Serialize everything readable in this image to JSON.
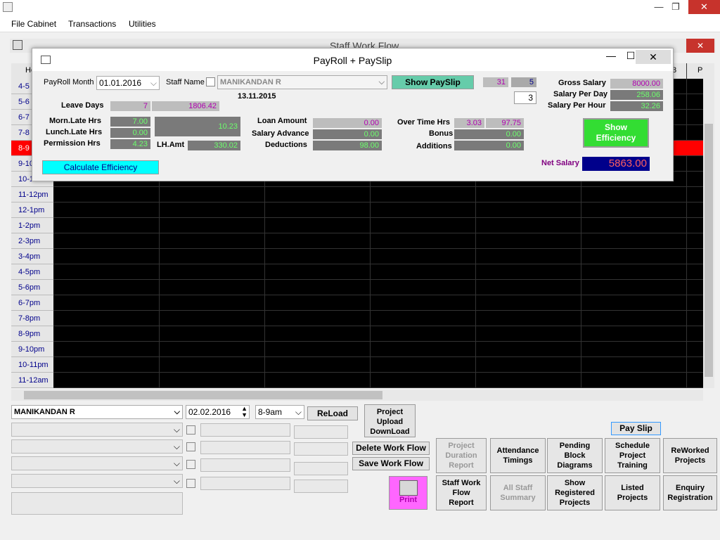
{
  "window": {
    "close": "✕",
    "minimize": "—",
    "restore": "❐"
  },
  "menu": [
    "File Cabinet",
    "Transactions",
    "Utilities"
  ],
  "inner_title": "Staff Work Flow",
  "grid": {
    "header_cells": [
      "He",
      "3",
      "P"
    ],
    "time_rows": [
      "4-5",
      "5-6",
      "6-7",
      "7-8",
      "8-9",
      "9-10",
      "10-11",
      "11-12pm",
      "12-1pm",
      "1-2pm",
      "2-3pm",
      "3-4pm",
      "4-5pm",
      "5-6pm",
      "6-7pm",
      "7-8pm",
      "8-9pm",
      "9-10pm",
      "10-11pm",
      "11-12am"
    ],
    "highlight_row": "8-9",
    "highlight_color": "#ff0000"
  },
  "dialog": {
    "title": "PayRoll + PaySlip",
    "payroll_month_label": "PayRoll Month",
    "payroll_month": "01.01.2016",
    "staff_name_label": "Staff Name",
    "staff_name": "MANIKANDAN R",
    "date": "13.11.2015",
    "show_payslip": "Show PaySlip",
    "val_31": "31",
    "val_5": "5",
    "val_3": "3",
    "leave_days_label": "Leave Days",
    "leave_days": "7",
    "leave_amt": "1806.42",
    "morn_late_label": "Morn.Late Hrs",
    "morn_late": "7.00",
    "lunch_late_label": "Lunch.Late Hrs",
    "lunch_late": "0.00",
    "permission_label": "Permission Hrs",
    "permission": "4.23",
    "late_total": "10.23",
    "lh_amt_label": "LH.Amt",
    "lh_amt": "330.02",
    "loan_label": "Loan Amount",
    "loan": "0.00",
    "salary_adv_label": "Salary Advance",
    "salary_adv": "0.00",
    "deductions_label": "Deductions",
    "deductions": "98.00",
    "overtime_label": "Over Time Hrs",
    "overtime_hrs": "3.03",
    "overtime_amt": "97.75",
    "bonus_label": "Bonus",
    "bonus": "0.00",
    "additions_label": "Additions",
    "additions": "0.00",
    "gross_label": "Gross Salary",
    "gross": "8000.00",
    "per_day_label": "Salary Per Day",
    "per_day": "258.06",
    "per_hour_label": "Salary Per Hour",
    "per_hour": "32.26",
    "show_eff": [
      "Show",
      "Efficiency"
    ],
    "calc_eff": "Calculate Efficiency",
    "net_label": "Net Salary",
    "net": "5863.00"
  },
  "bottom": {
    "staff": "MANIKANDAN R",
    "date": "02.02.2016",
    "slot": "8-9am",
    "reload": "ReLoad",
    "project_upload": [
      "Project",
      "Upload",
      "DownLoad"
    ],
    "delete_wf": "Delete Work Flow",
    "save_wf": "Save Work Flow",
    "print": "Print",
    "payslip": "Pay  Slip",
    "tiles": [
      [
        "Project",
        "Duration",
        "Report"
      ],
      [
        "Attendance",
        "Timings"
      ],
      [
        "Pending",
        "Block",
        "Diagrams"
      ],
      [
        "Schedule",
        "Project",
        "Training"
      ],
      [
        "ReWorked",
        "Projects"
      ],
      [
        "Staff Work",
        "Flow",
        "Report"
      ],
      [
        "All Staff",
        "Summary"
      ],
      [
        "Show",
        "Registered",
        "Projects"
      ],
      [
        "Listed",
        "Projects"
      ],
      [
        "Enquiry",
        "Registration"
      ]
    ]
  }
}
